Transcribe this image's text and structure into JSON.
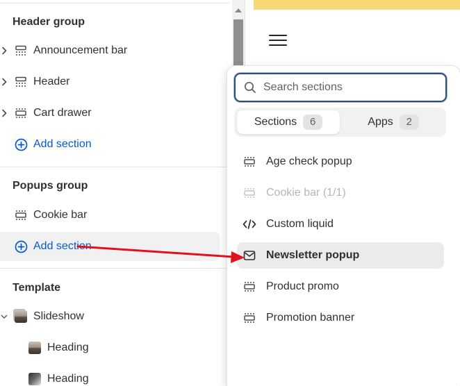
{
  "sidebar": {
    "header_group_title": "Header group",
    "header_items": [
      {
        "label": "Announcement bar",
        "icon": "section-icon"
      },
      {
        "label": "Header",
        "icon": "section-icon"
      },
      {
        "label": "Cart drawer",
        "icon": "section-icon"
      }
    ],
    "add_section_label": "Add section",
    "popups_group_title": "Popups group",
    "popups_items": [
      {
        "label": "Cookie bar",
        "icon": "section-icon"
      }
    ],
    "popups_add_section_label": "Add section",
    "template_title": "Template",
    "template_items": [
      {
        "label": "Slideshow",
        "icon": "slideshow-thumb"
      },
      {
        "label": "Heading",
        "icon": "image-thumb"
      },
      {
        "label": "Heading",
        "icon": "image-thumb"
      }
    ]
  },
  "popover": {
    "search_placeholder": "Search sections",
    "tabs": [
      {
        "label": "Sections",
        "count": "6"
      },
      {
        "label": "Apps",
        "count": "2"
      }
    ],
    "items": [
      {
        "label": "Age check popup",
        "icon": "section-icon",
        "state": "normal"
      },
      {
        "label": "Cookie bar (1/1)",
        "icon": "section-icon",
        "state": "disabled"
      },
      {
        "label": "Custom liquid",
        "icon": "code-icon",
        "state": "normal"
      },
      {
        "label": "Newsletter popup",
        "icon": "envelope-icon",
        "state": "selected"
      },
      {
        "label": "Product promo",
        "icon": "section-icon",
        "state": "normal"
      },
      {
        "label": "Promotion banner",
        "icon": "section-icon",
        "state": "normal"
      }
    ]
  },
  "colors": {
    "accent_link": "#005bd3",
    "announcement_strip": "#f8d774",
    "annotation_arrow": "#e0121b",
    "search_focus": "#2f4f79"
  }
}
